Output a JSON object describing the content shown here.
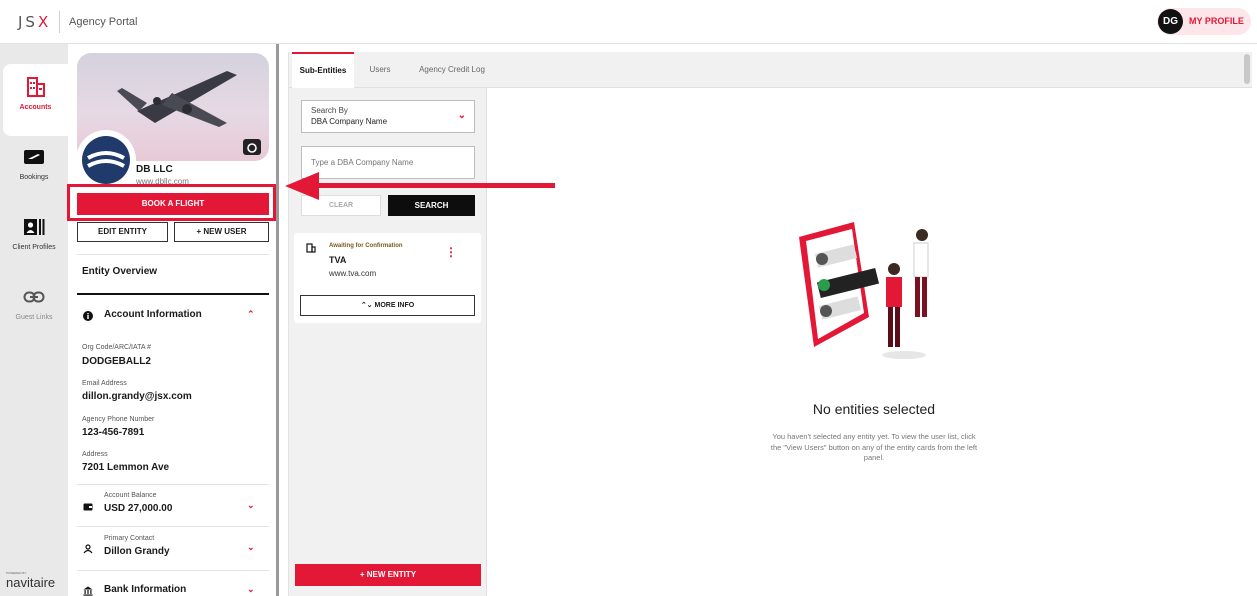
{
  "app": {
    "brand": "JSX",
    "portal_name": "Agency Portal"
  },
  "profile": {
    "initials": "DG",
    "label": "MY PROFILE"
  },
  "rail": {
    "items": [
      {
        "label": "Accounts",
        "icon": "accounts-icon",
        "active": true
      },
      {
        "label": "Bookings",
        "icon": "plane-ticket-icon"
      },
      {
        "label": "Client Profiles",
        "icon": "client-profiles-icon"
      },
      {
        "label": "Guest Links",
        "icon": "link-icon"
      }
    ],
    "powered_by": "POWERED BY",
    "footer": "navitaire"
  },
  "entity": {
    "name": "DB LLC",
    "website": "www.dbllc.com",
    "book_label": "BOOK A FLIGHT",
    "edit_label": "EDIT ENTITY",
    "new_user_label": "+ NEW USER",
    "overview_title": "Entity Overview",
    "account_info_title": "Account Information",
    "fields": [
      {
        "label": "Org Code/ARC/IATA #",
        "value": "DODGEBALL2"
      },
      {
        "label": "Email Address",
        "value": "dillon.grandy@jsx.com"
      },
      {
        "label": "Agency Phone Number",
        "value": "123-456-7891"
      },
      {
        "label": "Address",
        "value": "7201 Lemmon Ave"
      }
    ],
    "balance": {
      "label": "Account Balance",
      "value": "USD 27,000.00"
    },
    "contact": {
      "label": "Primary Contact",
      "value": "Dillon Grandy"
    },
    "bank_title": "Bank Information"
  },
  "tabs": [
    {
      "label": "Sub-Entities",
      "active": true
    },
    {
      "label": "Users"
    },
    {
      "label": "Agency Credit Log"
    }
  ],
  "search": {
    "by_label": "Search By",
    "by_value": "DBA Company Name",
    "input_placeholder": "Type a DBA Company Name",
    "clear_label": "CLEAR",
    "search_label": "SEARCH"
  },
  "sub_entity_card": {
    "status": "Awaiting for Confirmation",
    "title": "TVA",
    "url": "www.tva.com",
    "more_info_label": "MORE INFO"
  },
  "new_entity_label": "+ NEW ENTITY",
  "empty_state": {
    "title": "No entities selected",
    "text": "You haven't selected any entity yet. To view the user list, click the \"View Users\" button on any of the entity cards from the left panel."
  },
  "colors": {
    "accent": "#e31837",
    "dark": "#0d0d0d",
    "panel": "#f1f1f2"
  }
}
